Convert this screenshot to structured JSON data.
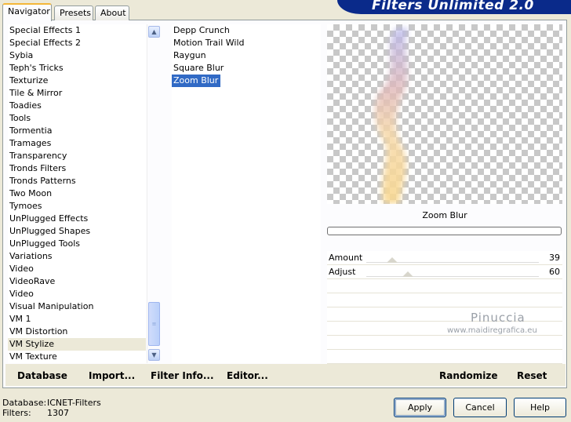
{
  "tabs": [
    {
      "label": "Navigator",
      "active": true
    },
    {
      "label": "Presets",
      "active": false
    },
    {
      "label": "About",
      "active": false
    }
  ],
  "banner_title": "Filters Unlimited 2.0",
  "categories": [
    "Special Effects 1",
    "Special Effects 2",
    "Sybia",
    "Teph's Tricks",
    "Texturize",
    "Tile & Mirror",
    "Toadies",
    "Tools",
    "Tormentia",
    "Tramages",
    "Transparency",
    "Tronds Filters",
    "Tronds Patterns",
    "Two Moon",
    "Tymoes",
    "UnPlugged Effects",
    "UnPlugged Shapes",
    "UnPlugged Tools",
    "Variations",
    "Video",
    "VideoRave",
    "Video",
    "Visual Manipulation",
    "VM 1",
    "VM Distortion",
    "VM Stylize",
    "VM Texture"
  ],
  "selected_category": "VM Stylize",
  "filters": [
    "Depp Crunch",
    "Motion Trail Wild",
    "Raygun",
    "Square Blur",
    "Zoom Blur"
  ],
  "selected_filter": "Zoom Blur",
  "preview": {
    "filter_name": "Zoom Blur"
  },
  "params": [
    {
      "label": "Amount",
      "value": "39",
      "level": 0.15
    },
    {
      "label": "Adjust",
      "value": "60",
      "level": 0.24
    }
  ],
  "watermark": {
    "name": "Pinuccia",
    "url": "www.maidiregrafica.eu"
  },
  "bottom_buttons": {
    "database": "Database",
    "import": "Import...",
    "filter_info": "Filter Info...",
    "editor": "Editor...",
    "randomize": "Randomize",
    "reset": "Reset"
  },
  "status": {
    "database_label": "Database:",
    "database_value": "ICNET-Filters",
    "filters_label": "Filters:",
    "filters_value": "1307"
  },
  "dialog_buttons": {
    "apply": "Apply",
    "cancel": "Cancel",
    "help": "Help"
  }
}
